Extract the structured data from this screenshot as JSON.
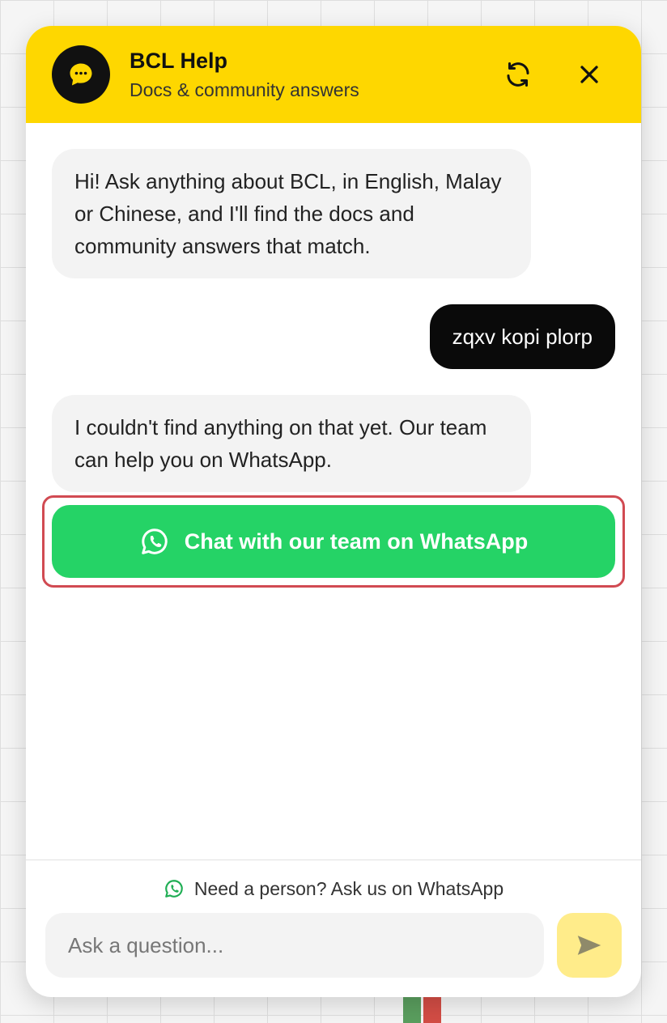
{
  "header": {
    "title": "BCL Help",
    "subtitle": "Docs & community answers",
    "accent_color": "#fed700",
    "avatar_icon": "chat-bubble-icon",
    "refresh_icon": "refresh-icon",
    "close_icon": "close-icon"
  },
  "messages": [
    {
      "role": "bot",
      "text": "Hi! Ask anything about BCL, in English, Malay or Chinese, and I'll find the docs and community answers that match."
    },
    {
      "role": "user",
      "text": "zqxv kopi plorp"
    },
    {
      "role": "bot",
      "text": "I couldn't find anything on that yet. Our team can help you on WhatsApp."
    }
  ],
  "whatsapp_cta": {
    "label": "Chat with our team on WhatsApp",
    "icon": "whatsapp-icon",
    "color": "#25d366",
    "highlight_color": "#d14a52"
  },
  "footer": {
    "help_link": "Need a person? Ask us on WhatsApp",
    "help_icon": "whatsapp-icon",
    "input_placeholder": "Ask a question...",
    "input_value": "",
    "send_icon": "send-icon"
  }
}
